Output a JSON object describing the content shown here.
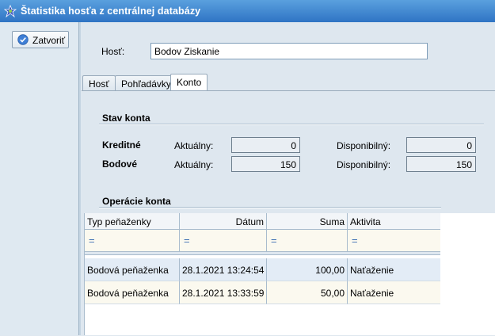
{
  "window": {
    "title": "Štatistika hosťa z centrálnej databázy"
  },
  "toolbar": {
    "close_label": "Zatvoriť"
  },
  "host": {
    "label": "Hosť:",
    "value": "Bodov Ziskanie"
  },
  "tabs": [
    {
      "label": "Hosť"
    },
    {
      "label": "Pohľadávky"
    },
    {
      "label": "Konto"
    }
  ],
  "account": {
    "section_title": "Stav konta",
    "rows": [
      {
        "label": "Kreditné",
        "current_label": "Aktuálny:",
        "current_value": "0",
        "available_label": "Disponibilný:",
        "available_value": "0"
      },
      {
        "label": "Bodové",
        "current_label": "Aktuálny:",
        "current_value": "150",
        "available_label": "Disponibilný:",
        "available_value": "150"
      }
    ]
  },
  "operations": {
    "section_title": "Operácie konta",
    "columns": [
      "Typ peňaženky",
      "Dátum",
      "Suma",
      "Aktivita"
    ],
    "filter_symbol": "=",
    "rows": [
      [
        "Bodová peňaženka",
        "28.1.2021 13:24:54",
        "100,00",
        "Naťaženie"
      ],
      [
        "Bodová peňaženka",
        "28.1.2021 13:33:59",
        "50,00",
        "Naťaženie"
      ]
    ]
  },
  "colors": {
    "title_bar": "#3a82d0",
    "row_highlight": "#e3ecf6",
    "row_alt": "#fbf9ef"
  }
}
